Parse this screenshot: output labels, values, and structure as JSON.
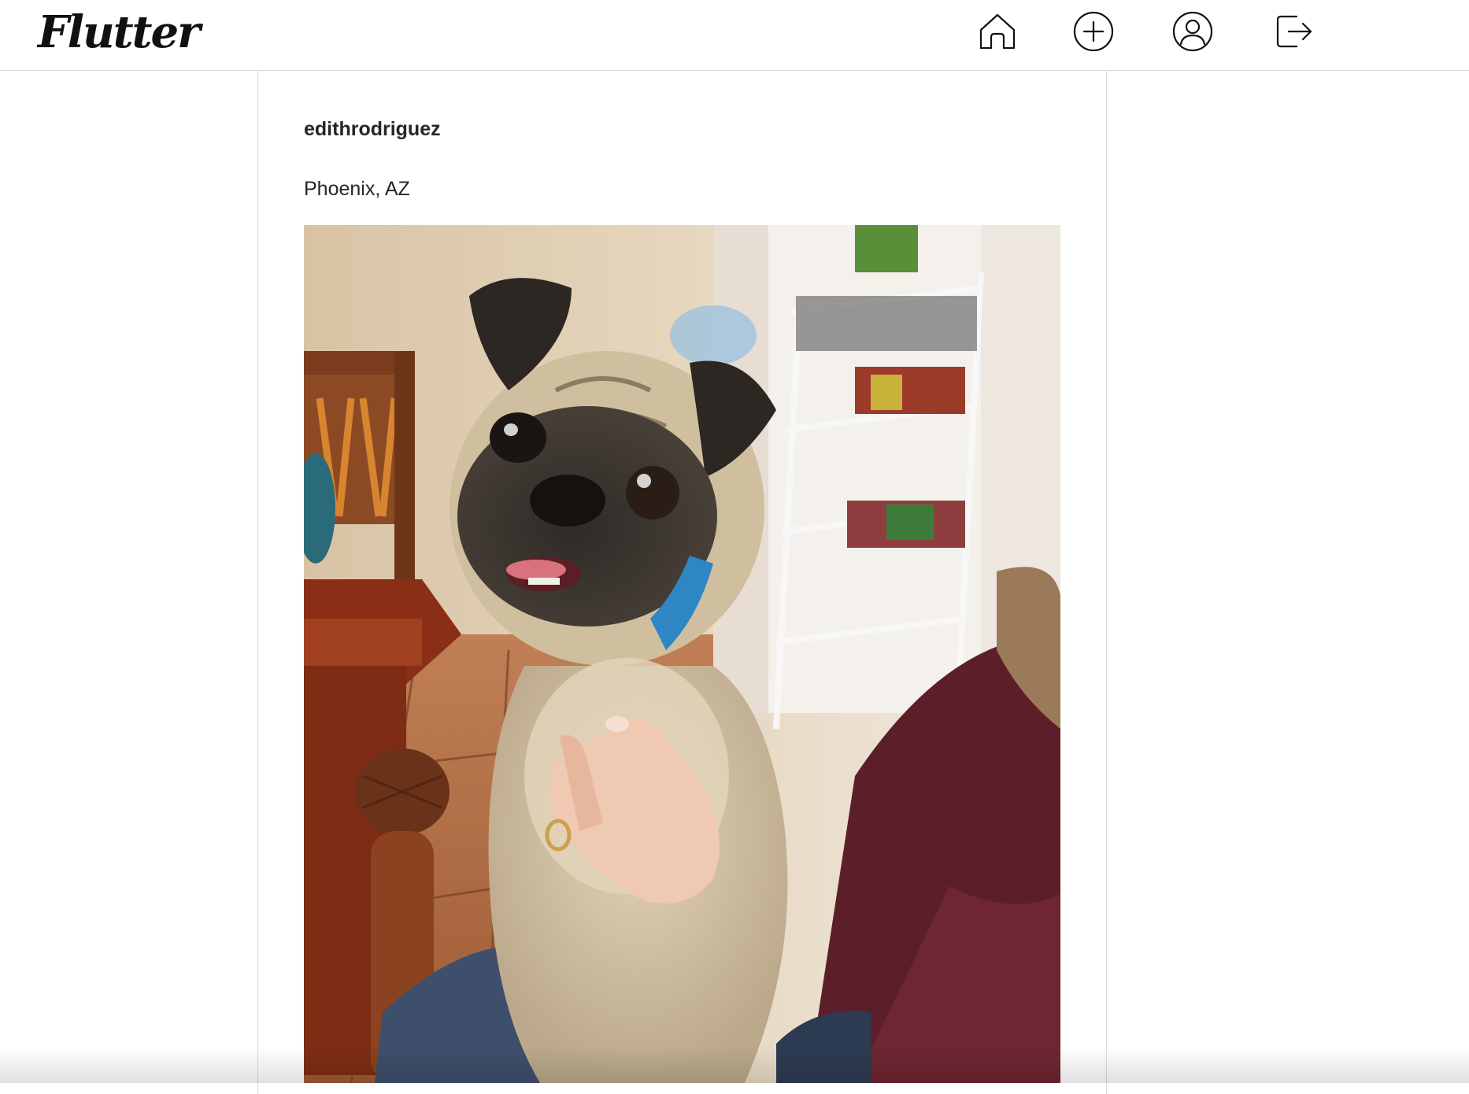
{
  "app": {
    "logo_text": "Flutter"
  },
  "nav": {
    "home_icon": "home-icon",
    "add_icon": "plus-circle-icon",
    "profile_icon": "user-circle-icon",
    "logout_icon": "logout-icon"
  },
  "post": {
    "username": "edithrodriguez",
    "location": "Phoenix, AZ",
    "image_description": "pug-photo"
  },
  "colors": {
    "border": "#dbdbdb",
    "text": "#262626",
    "background": "#ffffff"
  }
}
